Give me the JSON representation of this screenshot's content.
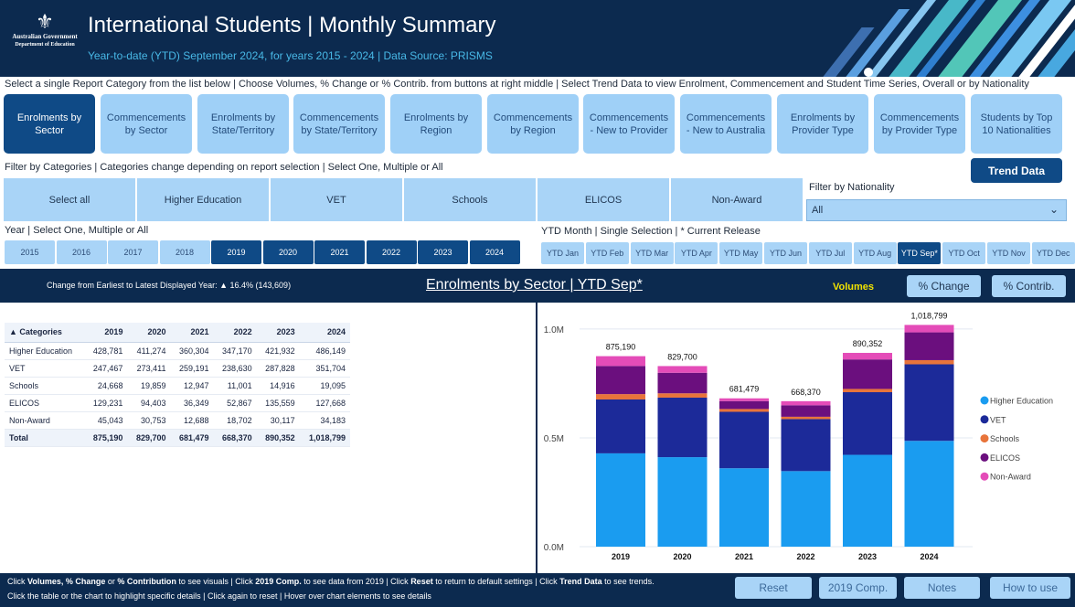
{
  "header": {
    "logo_line1": "Australian Government",
    "logo_line2": "Department of Education",
    "title": "International Students | Monthly Summary",
    "subtitle": "Year-to-date (YTD) September 2024, for years 2015 - 2024 | Data Source: PRISMS"
  },
  "instructions": "Select a single Report Category from the list below | Choose Volumes, % Change or % Contrib. from buttons at right middle | Select Trend Data to view Enrolment, Commencement and Student Time Series, Overall or by Nationality",
  "report_buttons": [
    {
      "label": "Enrolments by Sector"
    },
    {
      "label": "Commencements by Sector"
    },
    {
      "label": "Enrolments by State/Territory"
    },
    {
      "label": "Commencements by State/Territory"
    },
    {
      "label": "Enrolments by Region"
    },
    {
      "label": "Commencements by Region"
    },
    {
      "label": "Commencements - New to Provider"
    },
    {
      "label": "Commencements - New to Australia"
    },
    {
      "label": "Enrolments by Provider Type"
    },
    {
      "label": "Commencements by Provider Type"
    },
    {
      "label": "Students by Top 10 Nationalities"
    }
  ],
  "filter_label": "Filter by Categories | Categories change depending on report selection | Select One, Multiple or All",
  "trend_button": "Trend Data",
  "category_buttons": [
    "Select all",
    "Higher Education",
    "VET",
    "Schools",
    "ELICOS",
    "Non-Award"
  ],
  "nationality": {
    "label": "Filter by Nationality",
    "value": "All"
  },
  "year_label": "Year | Select One, Multiple or All",
  "years": [
    "2015",
    "2016",
    "2017",
    "2018",
    "2019",
    "2020",
    "2021",
    "2022",
    "2023",
    "2024"
  ],
  "selected_years": [
    "2019",
    "2020",
    "2021",
    "2022",
    "2023",
    "2024"
  ],
  "month_label": "YTD Month | Single Selection | * Current Release",
  "months": [
    "YTD Jan",
    "YTD Feb",
    "YTD Mar",
    "YTD Apr",
    "YTD May",
    "YTD Jun",
    "YTD Jul",
    "YTD Aug",
    "YTD Sep*",
    "YTD Oct",
    "YTD Nov",
    "YTD Dec"
  ],
  "selected_month": "YTD Sep*",
  "band": {
    "change_text": "Change from Earliest to Latest Displayed Year: ▲ 16.4% (143,609)",
    "chart_title": "Enrolments by Sector | YTD Sep*",
    "volumes": "Volumes",
    "pct_change": "% Change",
    "pct_contrib": "% Contrib."
  },
  "table": {
    "headers": [
      "Categories",
      "2019",
      "2020",
      "2021",
      "2022",
      "2023",
      "2024"
    ],
    "rows": [
      [
        "Higher Education",
        "428,781",
        "411,274",
        "360,304",
        "347,170",
        "421,932",
        "486,149"
      ],
      [
        "VET",
        "247,467",
        "273,411",
        "259,191",
        "238,630",
        "287,828",
        "351,704"
      ],
      [
        "Schools",
        "24,668",
        "19,859",
        "12,947",
        "11,001",
        "14,916",
        "19,095"
      ],
      [
        "ELICOS",
        "129,231",
        "94,403",
        "36,349",
        "52,867",
        "135,559",
        "127,668"
      ],
      [
        "Non-Award",
        "45,043",
        "30,753",
        "12,688",
        "18,702",
        "30,117",
        "34,183"
      ]
    ],
    "total": [
      "Total",
      "875,190",
      "829,700",
      "681,479",
      "668,370",
      "890,352",
      "1,018,799"
    ]
  },
  "chart_data": {
    "type": "bar",
    "stacked": true,
    "categories": [
      "2019",
      "2020",
      "2021",
      "2022",
      "2023",
      "2024"
    ],
    "series": [
      {
        "name": "Higher Education",
        "color": "#1a9cf0",
        "values": [
          428781,
          411274,
          360304,
          347170,
          421932,
          486149
        ]
      },
      {
        "name": "VET",
        "color": "#1c2a99",
        "values": [
          247467,
          273411,
          259191,
          238630,
          287828,
          351704
        ]
      },
      {
        "name": "Schools",
        "color": "#e8743b",
        "values": [
          24668,
          19859,
          12947,
          11001,
          14916,
          19095
        ]
      },
      {
        "name": "ELICOS",
        "color": "#6b0f7e",
        "values": [
          129231,
          94403,
          36349,
          52867,
          135559,
          127668
        ]
      },
      {
        "name": "Non-Award",
        "color": "#e44cb8",
        "values": [
          45043,
          30753,
          12688,
          18702,
          30117,
          34183
        ]
      }
    ],
    "totals": [
      "875,190",
      "829,700",
      "681,479",
      "668,370",
      "890,352",
      "1,018,799"
    ],
    "y_ticks": [
      "0.0M",
      "0.5M",
      "1.0M"
    ],
    "ylim": [
      0,
      1050000
    ],
    "legend_position": "right",
    "grid": true
  },
  "footer": {
    "line1_parts": [
      {
        "t": "Click ",
        "b": false
      },
      {
        "t": "Volumes, % Change",
        "b": true
      },
      {
        "t": " or ",
        "b": false
      },
      {
        "t": "% Contribution",
        "b": true
      },
      {
        "t": " to see visuals | Click ",
        "b": false
      },
      {
        "t": "2019 Comp.",
        "b": true
      },
      {
        "t": " to see data from 2019 | Click ",
        "b": false
      },
      {
        "t": "Reset",
        "b": true
      },
      {
        "t": " to return to default settings | Click ",
        "b": false
      },
      {
        "t": "Trend Data",
        "b": true
      },
      {
        "t": " to see trends.",
        "b": false
      }
    ],
    "line2": "Click the table or the chart to highlight specific details  |  Click again to reset  |  Hover over chart elements to see details",
    "buttons": [
      "Reset",
      "2019 Comp.",
      "Notes",
      "How to use"
    ]
  }
}
